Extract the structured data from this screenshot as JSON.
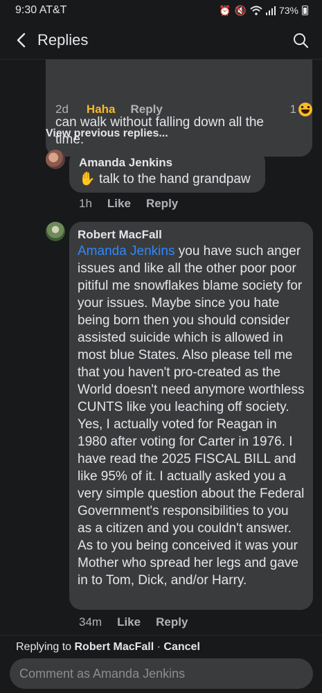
{
  "status_bar": {
    "time": "9:30",
    "carrier": "AT&T",
    "battery": "73%"
  },
  "header": {
    "title": "Replies",
    "back_icon": "chevron-left-icon",
    "search_icon": "search-icon"
  },
  "top_comment": {
    "text_line1": "can walk without falling down all the",
    "text_line2": "time.",
    "time": "2d",
    "reaction_label": "Haha",
    "reply_label": "Reply",
    "reaction_count": "1"
  },
  "view_previous": "View previous replies...",
  "reply_aj": {
    "name": "Amanda Jenkins",
    "emoji": "✋",
    "text": "talk to the hand grandpaw",
    "time": "1h",
    "like_label": "Like",
    "reply_label": "Reply"
  },
  "reply_rm": {
    "name": "Robert MacFall",
    "mention": "Amanda Jenkins",
    "text": " you have such anger issues and like all the other poor poor pitiful me snowflakes blame society for your issues. Maybe since you hate being born then you should consider assisted suicide which is allowed in most blue States. Also please tell me that you haven't pro-created as the World doesn't need anymore worthless CUNTS  like you leaching off society. Yes, I actually voted for Reagan in 1980 after voting for Carter in 1976. I have read the 2025 FISCAL BILL and like 95% of it. I actually asked you a very simple question about the Federal Government's responsibilities to you as a citizen and you couldn't answer. As to you being conceived it was your Mother who spread her legs and gave in to Tom, Dick, and/or Harry.",
    "time": "34m",
    "like_label": "Like",
    "reply_label": "Reply"
  },
  "composer": {
    "replying_prefix": "Replying to",
    "replying_to": "Robert MacFall",
    "separator": "·",
    "cancel_label": "Cancel",
    "placeholder": "Comment as Amanda Jenkins"
  },
  "colors": {
    "background": "#18191a",
    "bubble": "#3a3b3c",
    "mention": "#2d88ff",
    "haha": "#f7b928"
  }
}
